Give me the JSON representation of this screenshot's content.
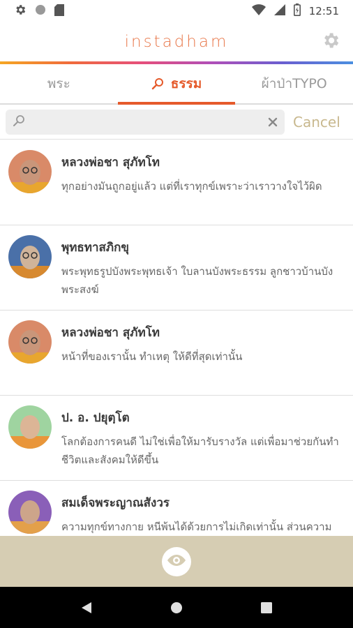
{
  "status_bar": {
    "time": "12:51"
  },
  "app": {
    "title": "instadham"
  },
  "tabs": [
    {
      "label": "พระ"
    },
    {
      "label": "ธรรม"
    },
    {
      "label": "ผ้าป่าTYPO"
    }
  ],
  "search": {
    "value": "",
    "placeholder": "",
    "cancel_label": "Cancel"
  },
  "quotes": [
    {
      "author": "หลวงพ่อชา สุภัทโท",
      "text": "ทุกอย่างมันถูกอยู่แล้ว แต่ที่เราทุกข์เพราะว่าเราวางใจไว้ผิด"
    },
    {
      "author": "พุทธทาสภิกขุ",
      "text": "พระพุทธรูปบังพระพุทธเจ้า ใบลานบังพระธรรม ลูกชาวบ้านบังพระสงฆ์"
    },
    {
      "author": "หลวงพ่อชา สุภัทโท",
      "text": "หน้าที่ของเรานั้น ทำเหตุ ให้ดีที่สุดเท่านั้น"
    },
    {
      "author": "ป. อ. ปยุตฺโต",
      "text": "โลกต้องการคนดี ไม่ใช่เพื่อให้มารับรางวัล แต่เพื่อมาช่วยกันทำชีวิตและสังคมให้ดีขึ้น"
    },
    {
      "author": "สมเด็จพระญาณสังวร",
      "text": "ความทุกข์ทางกาย หนีพ้นได้ด้วยการไม่เกิดเท่านั้น ส่วนความทุกข์ทางใจ หนีได้ด้วยความคิด"
    }
  ],
  "colors": {
    "accent": "#e55a2b",
    "title": "#e8774a",
    "cancel": "#c8b88e",
    "bottom_bar": "#d6cdb3"
  }
}
